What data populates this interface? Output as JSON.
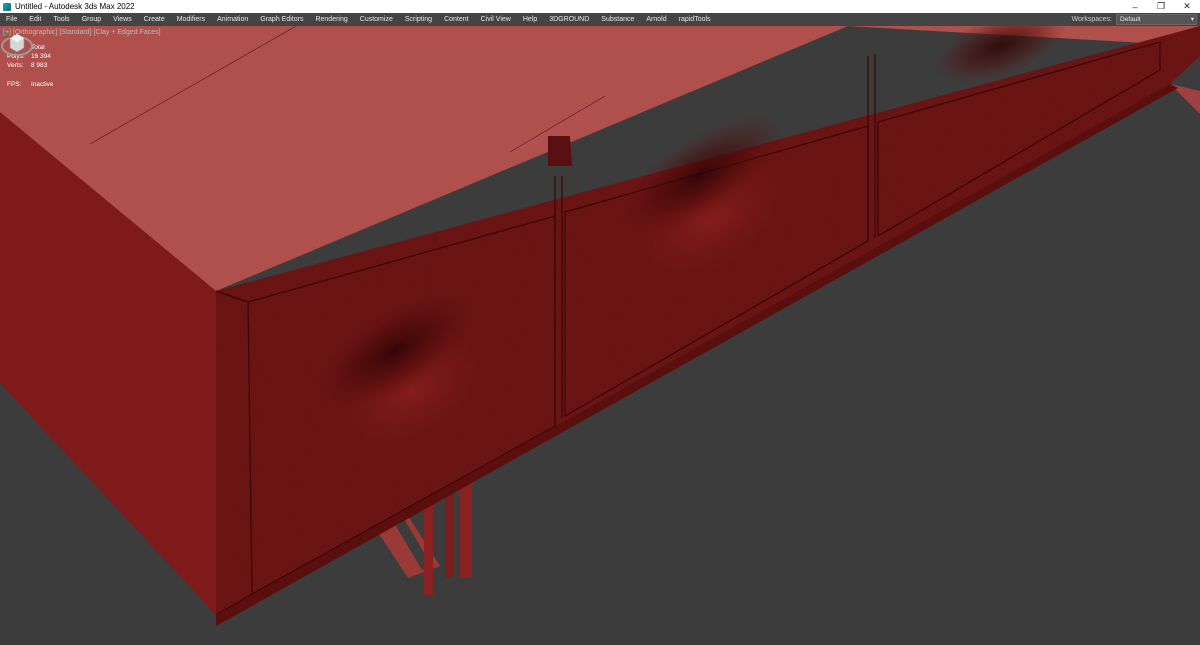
{
  "window": {
    "title": "Untitled - Autodesk 3ds Max 2022",
    "minimize_glyph": "–",
    "restore_glyph": "❐",
    "close_glyph": "✕"
  },
  "menu": {
    "items": [
      "File",
      "Edit",
      "Tools",
      "Group",
      "Views",
      "Create",
      "Modifiers",
      "Animation",
      "Graph Editors",
      "Rendering",
      "Customize",
      "Scripting",
      "Content",
      "Civil View",
      "Help",
      "3DGROUND",
      "Substance",
      "Arnold",
      "rapidTools"
    ],
    "workspaces_label": "Workspaces:",
    "workspace_value": "Default"
  },
  "viewport": {
    "label": "[+] [Orthographic] [Standard] [Clay + Edged Faces]",
    "stats": {
      "header": "Total",
      "polys_label": "Polys:",
      "polys_value": "16 394",
      "verts_label": "Verts:",
      "verts_value": "8 983",
      "fps_label": "FPS:",
      "fps_value": "Inactive"
    },
    "colors": {
      "background": "#3c3c3c",
      "clay_top": "#b0504c",
      "clay_front": "#6a1414",
      "clay_side": "#7e1a1a"
    }
  }
}
